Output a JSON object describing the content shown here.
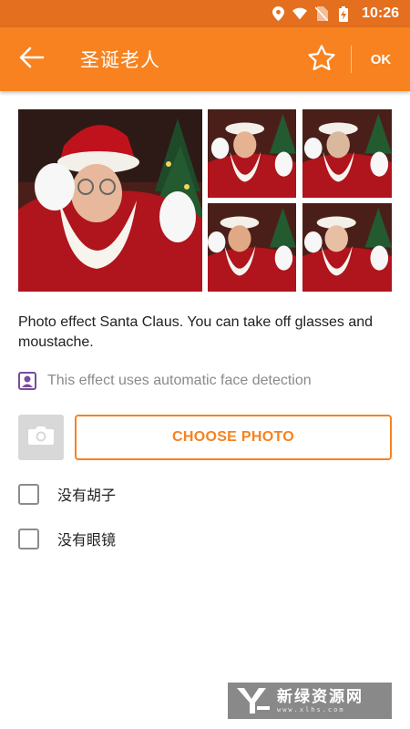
{
  "status_bar": {
    "time": "10:26",
    "icons": [
      "location-icon",
      "wifi-icon",
      "no-sim-icon",
      "battery-charging-icon"
    ]
  },
  "app_bar": {
    "title": "圣诞老人",
    "ok_label": "OK",
    "back_icon": "arrow-left-icon",
    "favorite_icon": "star-outline-icon"
  },
  "gallery": {
    "main_photo": "santa-claus-main-photo",
    "thumbnails": [
      "santa-thumb-1",
      "santa-thumb-2",
      "santa-thumb-3",
      "santa-thumb-4"
    ]
  },
  "description": "Photo effect Santa Claus. You can take off glasses and moustache.",
  "face_detection": {
    "icon": "face-detection-icon",
    "text": "This effect uses automatic face detection"
  },
  "actions": {
    "camera_icon": "camera-icon",
    "choose_photo_label": "CHOOSE PHOTO"
  },
  "options": [
    {
      "label": "没有胡子",
      "checked": false
    },
    {
      "label": "没有眼镜",
      "checked": false
    }
  ],
  "watermark": {
    "brand": "新绿资源网",
    "url": "www.xlhs.com"
  },
  "colors": {
    "accent": "#f7821f",
    "status_bar": "#e46f1e",
    "face_icon": "#7a4ba0",
    "checkbox_border": "#8c8c8c"
  }
}
